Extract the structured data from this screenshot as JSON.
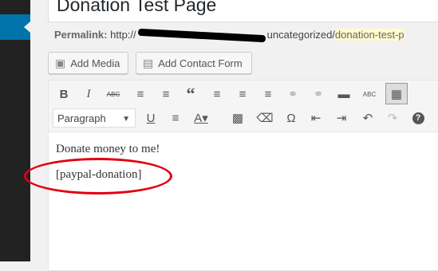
{
  "title": "Donation Test Page",
  "permalink": {
    "label": "Permalink:",
    "prefix": "http://",
    "middle": "uncategorized/",
    "slug": "donation-test-p"
  },
  "media_buttons": [
    {
      "label": "Add Media",
      "icon": "media-icon"
    },
    {
      "label": "Add Contact Form",
      "icon": "form-icon"
    }
  ],
  "toolbar": {
    "format_select": "Paragraph",
    "row1": [
      "bold",
      "italic",
      "strikethrough",
      "bullet-list",
      "numbered-list",
      "blockquote",
      "align-left",
      "align-center",
      "align-right",
      "insert-link",
      "remove-link",
      "read-more",
      "spellcheck",
      "toolbar-toggle"
    ],
    "row2": [
      "underline",
      "justify",
      "text-color",
      "paste-as-text",
      "clear-formatting",
      "special-character",
      "outdent",
      "indent",
      "undo",
      "redo",
      "help"
    ]
  },
  "content": {
    "line1": "Donate money to me!",
    "line2": "[paypal-donation]"
  },
  "colors": {
    "accent": "#0073aa",
    "highlight_oval": "#e3000f",
    "slug_bg": "#fffbcc"
  }
}
